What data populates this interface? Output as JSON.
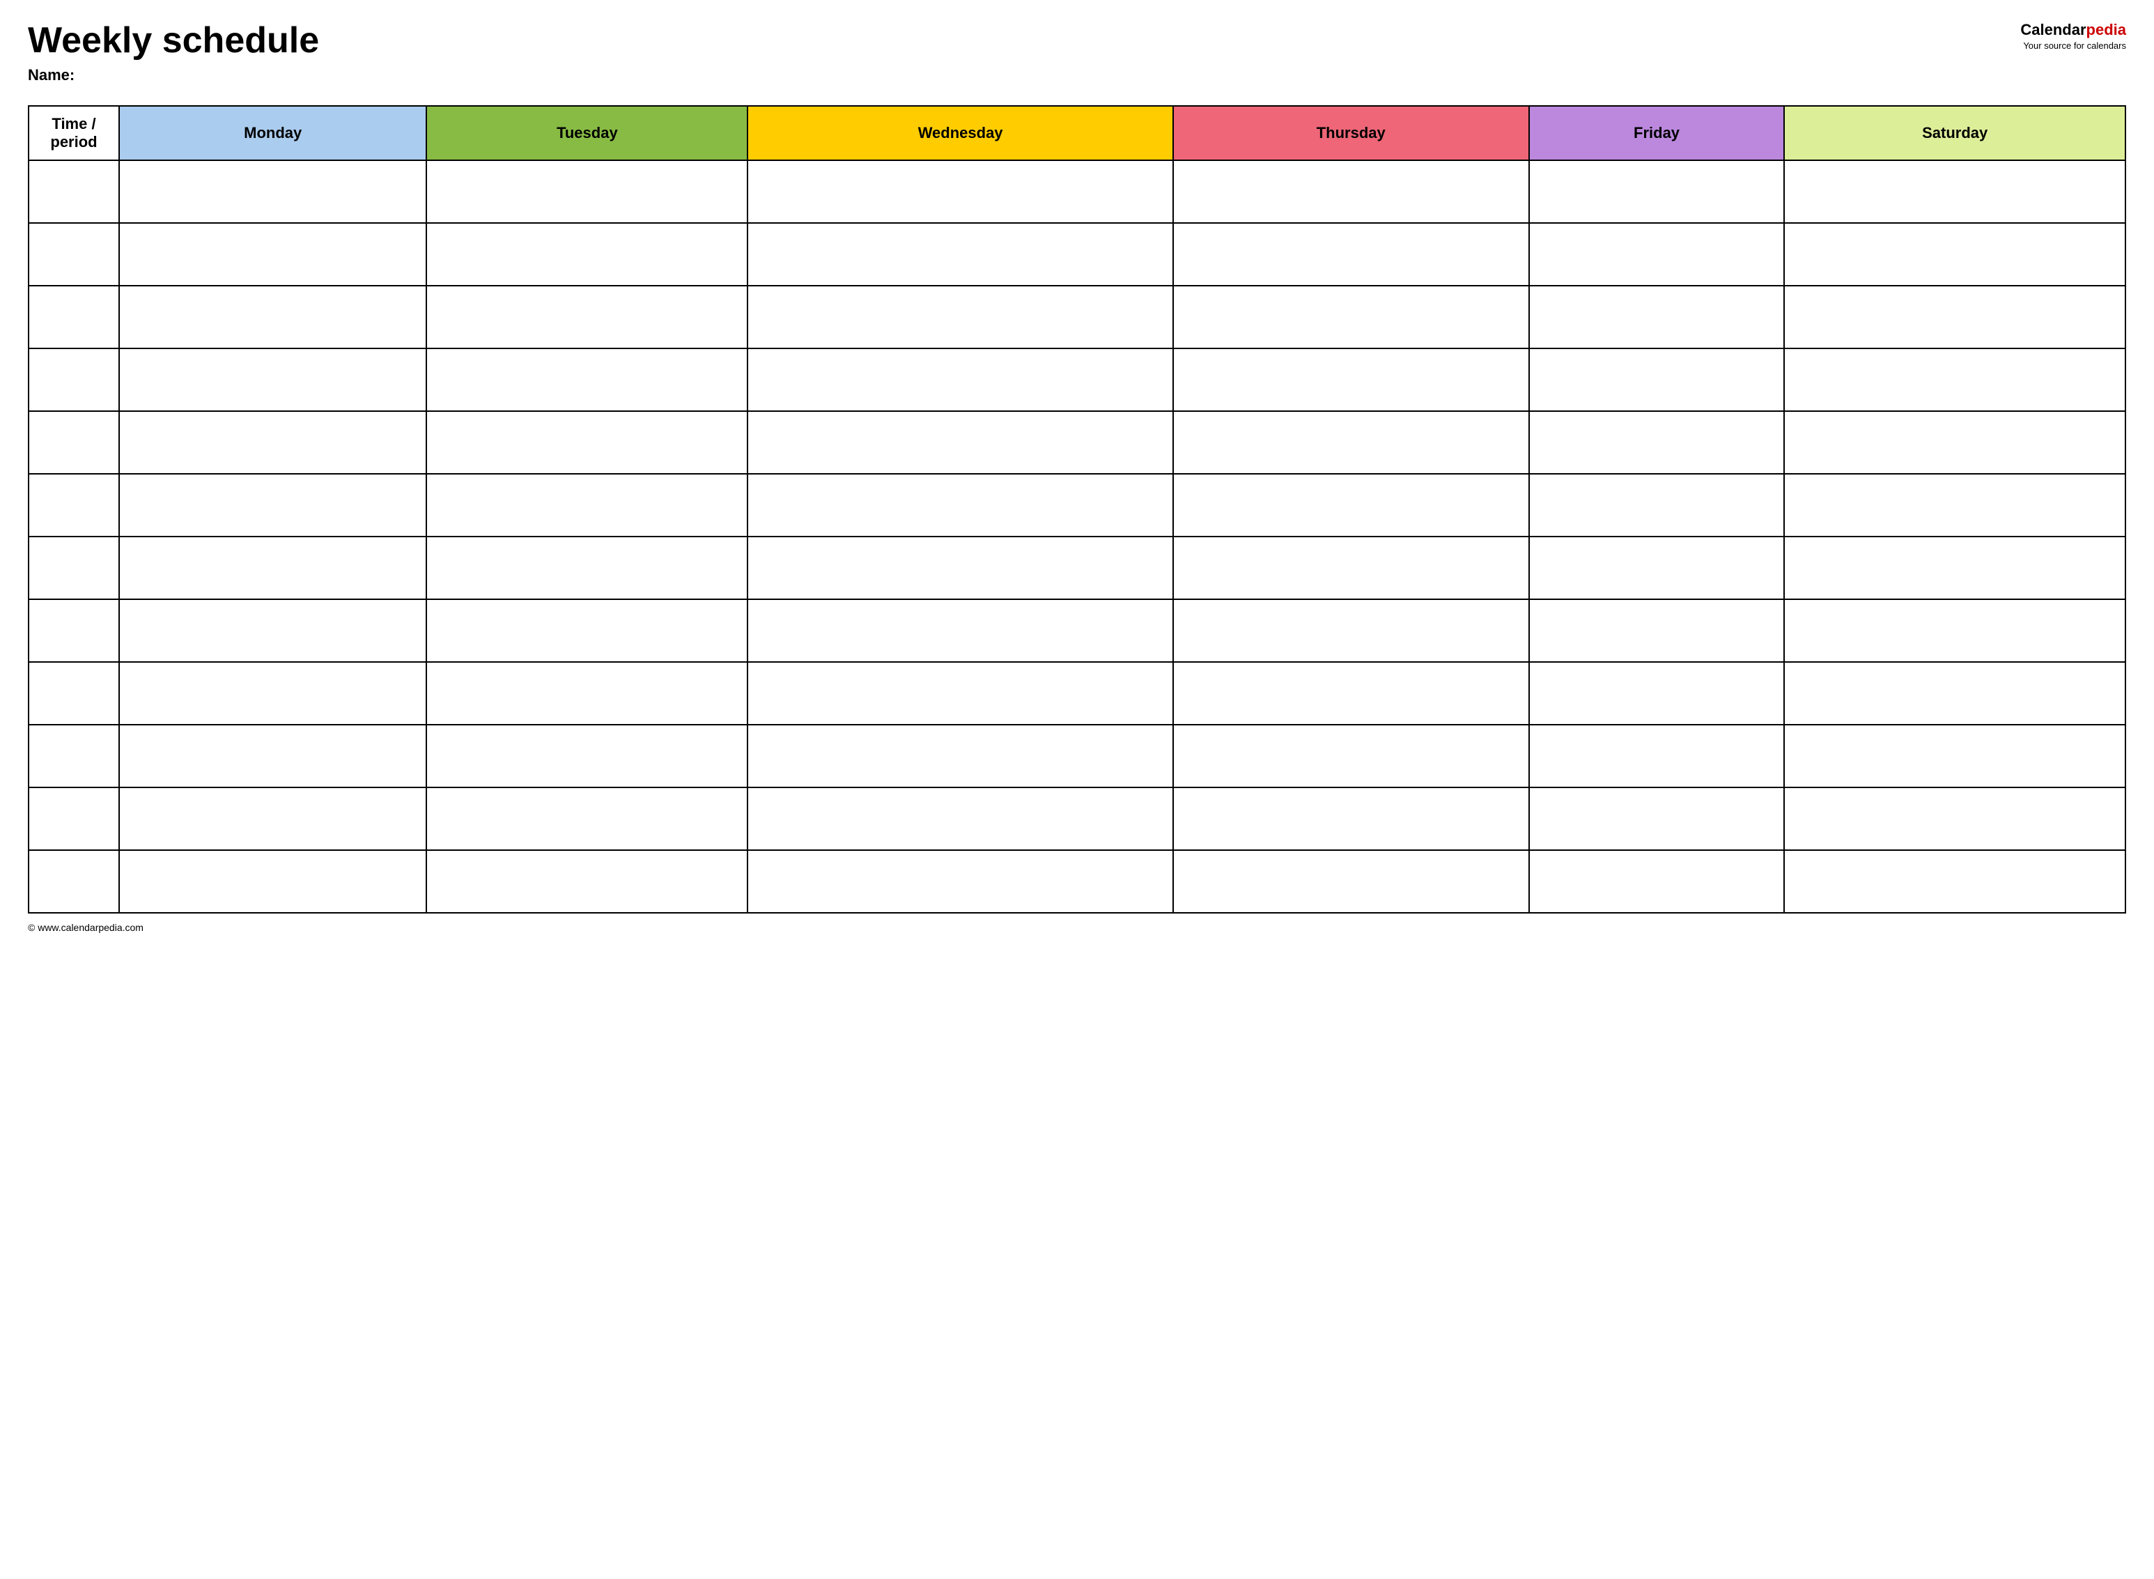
{
  "header": {
    "title": "Weekly schedule",
    "name_label": "Name:",
    "logo_calendar": "Calendar",
    "logo_pedia": "pedia",
    "logo_tagline": "Your source for calendars"
  },
  "table": {
    "columns": [
      {
        "key": "time",
        "label": "Time / period",
        "color_class": "col-time"
      },
      {
        "key": "monday",
        "label": "Monday",
        "color_class": "col-monday"
      },
      {
        "key": "tuesday",
        "label": "Tuesday",
        "color_class": "col-tuesday"
      },
      {
        "key": "wednesday",
        "label": "Wednesday",
        "color_class": "col-wednesday"
      },
      {
        "key": "thursday",
        "label": "Thursday",
        "color_class": "col-thursday"
      },
      {
        "key": "friday",
        "label": "Friday",
        "color_class": "col-friday"
      },
      {
        "key": "saturday",
        "label": "Saturday",
        "color_class": "col-saturday"
      }
    ],
    "rows": 12
  },
  "footer": {
    "url": "© www.calendarpedia.com"
  }
}
